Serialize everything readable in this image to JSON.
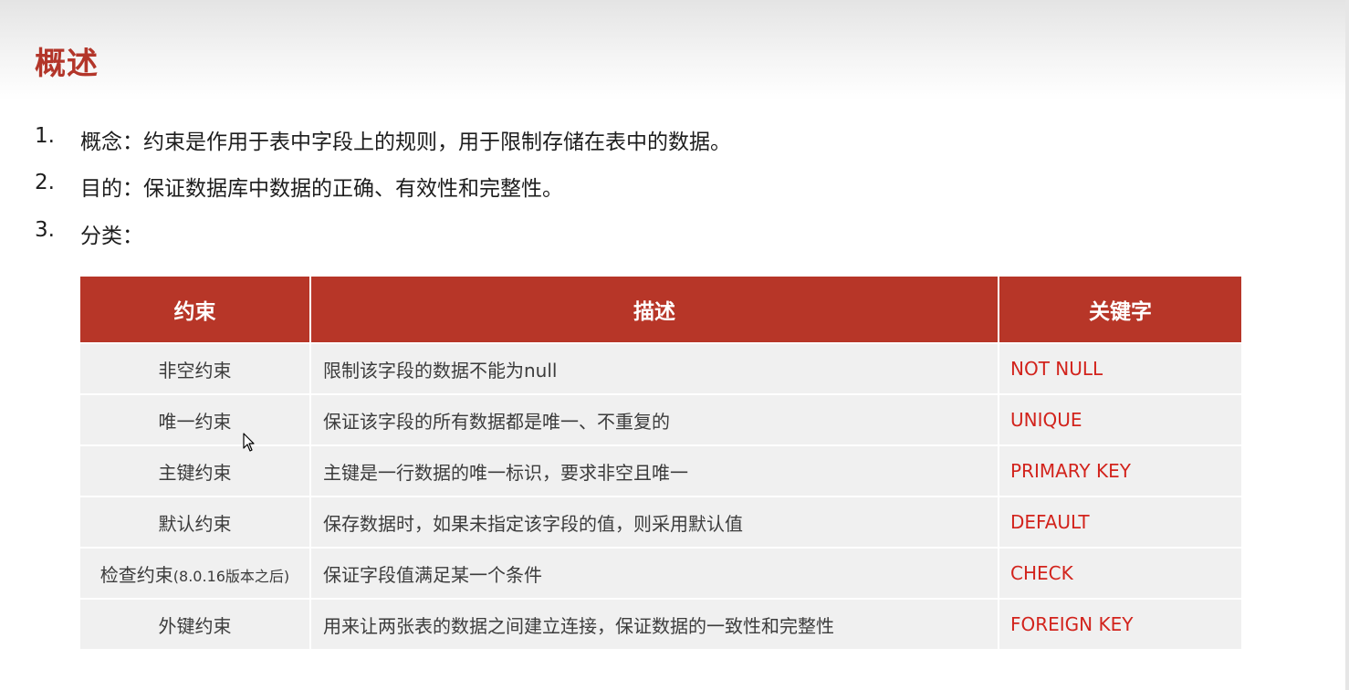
{
  "title": "概述",
  "list": [
    {
      "num": "1.",
      "text": "概念：约束是作用于表中字段上的规则，用于限制存储在表中的数据。"
    },
    {
      "num": "2.",
      "text": "目的：保证数据库中数据的正确、有效性和完整性。"
    },
    {
      "num": "3.",
      "text": "分类："
    }
  ],
  "table": {
    "headers": [
      "约束",
      "描述",
      "关键字"
    ],
    "rows": [
      {
        "name": "非空约束",
        "note": "",
        "desc": "限制该字段的数据不能为null",
        "keyword": "NOT NULL"
      },
      {
        "name": "唯一约束",
        "note": "",
        "desc": "保证该字段的所有数据都是唯一、不重复的",
        "keyword": "UNIQUE"
      },
      {
        "name": "主键约束",
        "note": "",
        "desc": "主键是一行数据的唯一标识，要求非空且唯一",
        "keyword": "PRIMARY KEY"
      },
      {
        "name": "默认约束",
        "note": "",
        "desc": "保存数据时，如果未指定该字段的值，则采用默认值",
        "keyword": "DEFAULT"
      },
      {
        "name": "检查约束",
        "note": "(8.0.16版本之后)",
        "desc": "保证字段值满足某一个条件",
        "keyword": "CHECK"
      },
      {
        "name": "外键约束",
        "note": "",
        "desc": "用来让两张表的数据之间建立连接，保证数据的一致性和完整性",
        "keyword": "FOREIGN KEY"
      }
    ]
  },
  "colors": {
    "accent": "#b73628",
    "title": "#b3362a",
    "keyword": "#d2231c",
    "row_bg": "#f0f0f0"
  },
  "icons": {
    "cursor": "mouse-pointer-icon"
  }
}
